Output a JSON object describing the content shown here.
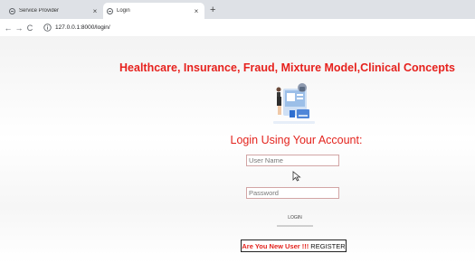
{
  "browser": {
    "tabs": [
      {
        "title": "Service Provider",
        "active": false
      },
      {
        "title": "Login",
        "active": true
      }
    ],
    "close_glyph": "×",
    "new_tab_glyph": "+",
    "nav": {
      "back": "←",
      "forward": "→",
      "reload": "C"
    },
    "url": "127.0.0.1:8000/login/"
  },
  "page": {
    "heading": "Healthcare, Insurance, Fraud, Mixture Model,Clinical Concepts",
    "login_title": "Login Using Your Account:",
    "username_placeholder": "User Name",
    "password_placeholder": "Password",
    "login_button": "LOGIN",
    "new_user_text": "Are You New User !!!",
    "register_link": "REGISTER"
  },
  "colors": {
    "accent_red": "#e3231d",
    "page_bg": "#ffffff",
    "tabstrip_bg": "#dee1e6"
  },
  "icons": [
    "globe-favicon-icon",
    "close-icon",
    "new-tab-icon",
    "back-arrow-icon",
    "forward-arrow-icon",
    "reload-icon",
    "info-icon",
    "login-illustration",
    "mouse-cursor-icon"
  ]
}
